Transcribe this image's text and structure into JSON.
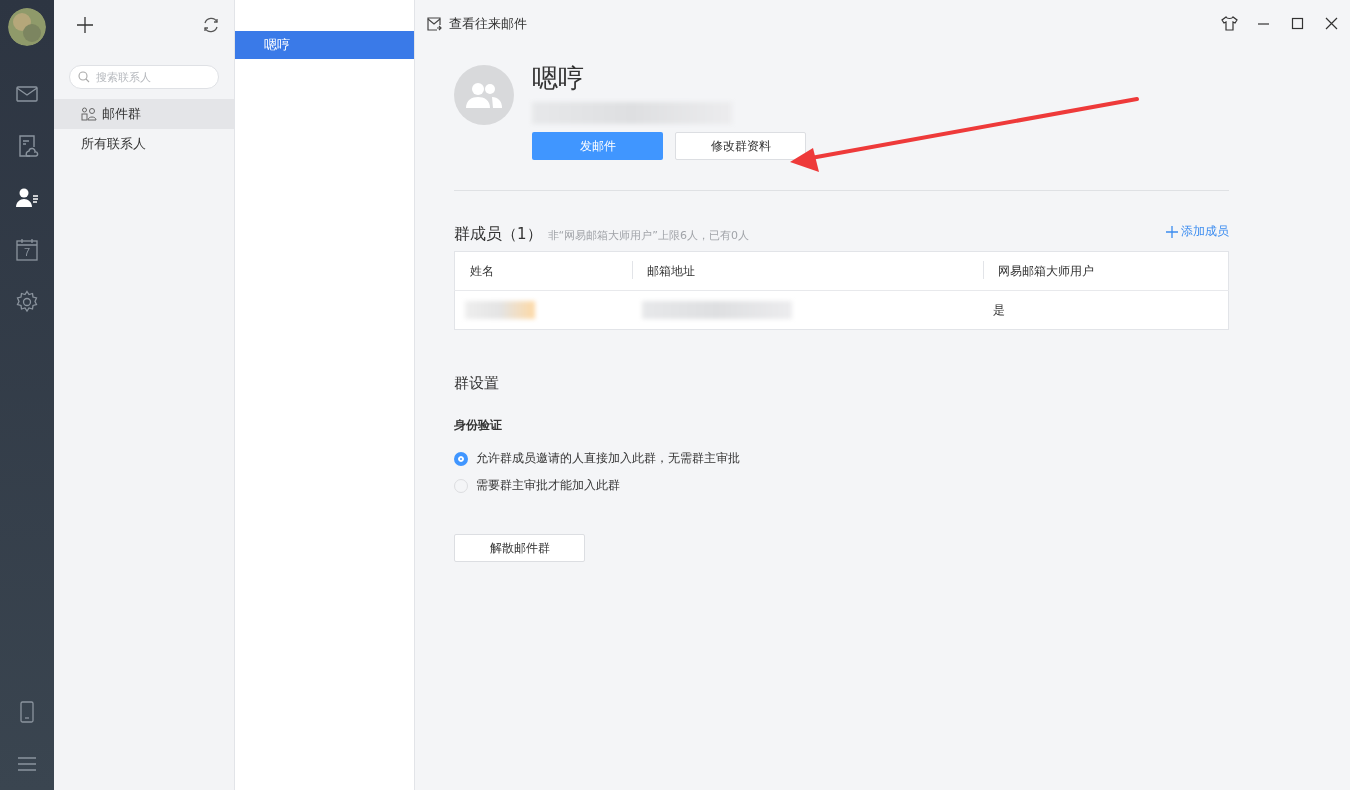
{
  "nav": {
    "items": [
      {
        "kind": "mail",
        "selected": false
      },
      {
        "kind": "cloud",
        "selected": false
      },
      {
        "kind": "contacts",
        "selected": true
      },
      {
        "kind": "calendar",
        "selected": false,
        "label": "7"
      },
      {
        "kind": "settings",
        "selected": false
      }
    ],
    "bottom": [
      {
        "kind": "phone"
      },
      {
        "kind": "menu"
      }
    ]
  },
  "contacts": {
    "search": {
      "placeholder": "搜索联系人"
    },
    "groups": [
      {
        "label": "邮件群",
        "kind": "group",
        "selected": true
      },
      {
        "label": "所有联系人",
        "kind": "plain",
        "selected": false
      }
    ]
  },
  "list": {
    "items": [
      {
        "label": "嗯哼",
        "selected": true
      }
    ]
  },
  "toolbar": {
    "title": "查看往来邮件"
  },
  "profile": {
    "name": "嗯哼",
    "buttons": [
      {
        "label": "发邮件",
        "kind": "primary"
      },
      {
        "label": "修改群资料",
        "kind": "default"
      }
    ]
  },
  "members": {
    "title": "群成员",
    "count": "（1）",
    "note": "非“网易邮箱大师用户”上限6人，已有0人",
    "add": "添加成员",
    "table": {
      "columns": [
        "姓名",
        "邮箱地址",
        "网易邮箱大师用户"
      ],
      "rows": [
        {
          "cells": [
            {
              "redacted": true
            },
            {
              "redacted": true
            },
            {
              "redacted": false,
              "text": "是"
            }
          ]
        }
      ]
    }
  },
  "settings": {
    "title": "群设置",
    "subtitle": "身份验证",
    "options": [
      {
        "label": "允许群成员邀请的人直接加入此群，无需群主审批",
        "selected": true
      },
      {
        "label": "需要群主审批才能加入此群",
        "selected": false
      }
    ],
    "disband": "解散邮件群"
  }
}
